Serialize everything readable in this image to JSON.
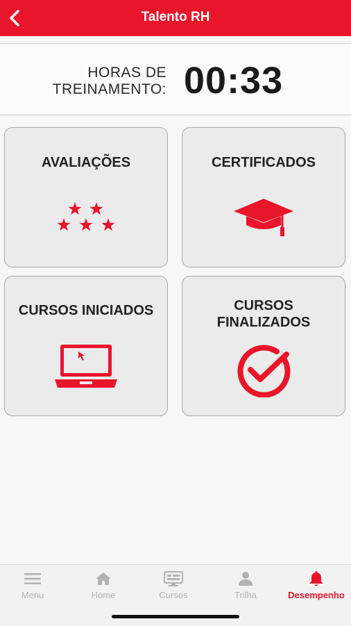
{
  "header": {
    "title": "Talento RH",
    "back_icon": "chevron-left-icon"
  },
  "training": {
    "label_line1": "HORAS DE",
    "label_line2": "TREINAMENTO:",
    "value": "00:33"
  },
  "cards": {
    "avaliacoes": {
      "title": "AVALIAÇÕES",
      "icon": "stars-icon"
    },
    "certificados": {
      "title": "CERTIFICADOS",
      "icon": "graduation-cap-icon"
    },
    "cursos_iniciados": {
      "title": "CURSOS INICIADOS",
      "icon": "laptop-icon"
    },
    "cursos_finalizados": {
      "title_line1": "CURSOS",
      "title_line2": "FINALIZADOS",
      "icon": "check-circle-icon"
    }
  },
  "nav": [
    {
      "label": "Menu",
      "icon": "hamburger-icon",
      "active": false
    },
    {
      "label": "Home",
      "icon": "home-icon",
      "active": false
    },
    {
      "label": "Cursos",
      "icon": "courses-icon",
      "active": false
    },
    {
      "label": "Trilha",
      "icon": "person-icon",
      "active": false
    },
    {
      "label": "Desempenho",
      "icon": "bell-icon",
      "active": true
    }
  ],
  "colors": {
    "accent": "#e8152b",
    "inactive": "#b3b3b3"
  }
}
